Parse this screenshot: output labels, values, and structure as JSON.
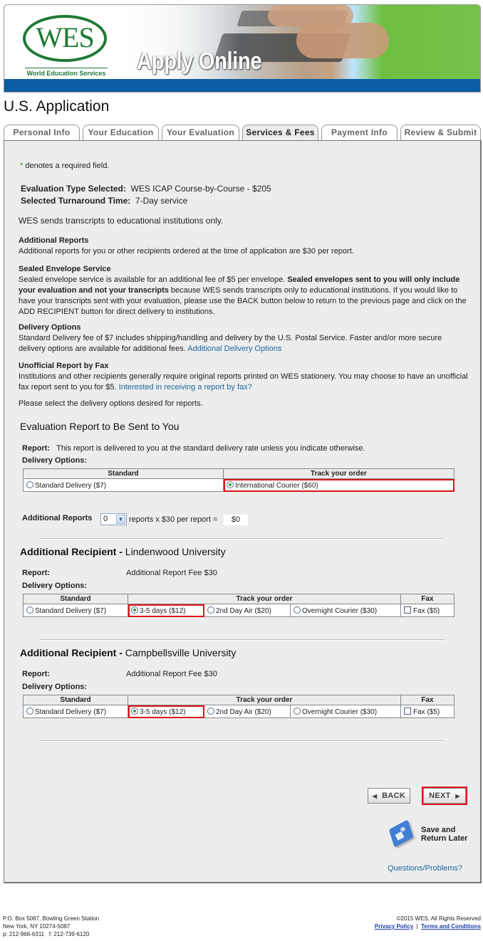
{
  "header": {
    "logo_text": "WES",
    "logo_subtitle": "World Education Services",
    "banner_title": "Apply Online",
    "brand_color": "#1e7a33",
    "bar_color": "#0a5ea6"
  },
  "page_title": "U.S. Application",
  "tabs": [
    {
      "label": "Personal Info",
      "active": false
    },
    {
      "label": "Your Education",
      "active": false
    },
    {
      "label": "Your Evaluation",
      "active": false
    },
    {
      "label": "Services & Fees",
      "active": true
    },
    {
      "label": "Payment Info",
      "active": false
    },
    {
      "label": "Review & Submit",
      "active": false
    }
  ],
  "intro": {
    "required_marker": "*",
    "required_note": " denotes a required field.",
    "eval_type_label": "Evaluation Type Selected:",
    "eval_type_value": "WES ICAP Course-by-Course - $205",
    "turnaround_label": "Selected Turnaround Time:",
    "turnaround_value": "7-Day service",
    "transcripts_note": "WES sends transcripts to educational institutions only."
  },
  "info_sections": {
    "additional_reports": {
      "heading": "Additional Reports",
      "text": "Additional reports for you or other recipients ordered at the time of application are $30 per report."
    },
    "sealed_envelope": {
      "heading": "Sealed Envelope Service",
      "text_1": "Sealed envelope service is available for an additional fee of $5 per envelope. ",
      "text_bold": "Sealed envelopes sent to you will only include your evaluation and not your transcripts",
      "text_2": " because WES sends transcripts only to educational institutions. If you would like to have your transcripts sent with your evaluation, please use the BACK button below to return to the previous page and click on the ADD RECIPIENT button for direct delivery to institutions."
    },
    "delivery_options": {
      "heading": "Delivery Options",
      "text": "Standard Delivery fee of $7 includes shipping/handling and delivery by the U.S. Postal Service. Faster and/or more secure delivery options are available for additional fees. ",
      "link": "Additional Delivery Options"
    },
    "fax": {
      "heading": "Unofficial Report by Fax",
      "text": "Institutions and other recipients generally require original reports printed on WES stationery. You may choose to have an unofficial fax report sent to you for $5. ",
      "link": "Interested in receiving a report by fax?"
    },
    "select_prompt": "Please select the delivery options desired for reports."
  },
  "eval_report": {
    "heading": "Evaluation Report to Be Sent to You",
    "report_label": "Report:",
    "report_text": "This report is delivered to you at the standard delivery rate unless you indicate otherwise.",
    "delivery_label": "Delivery Options:",
    "col_standard": "Standard",
    "col_track": "Track your order",
    "option_standard": "Standard Delivery ($7)",
    "option_courier": "International Courier ($60)",
    "selected": "International Courier ($60)"
  },
  "additional_reports_calc": {
    "label": "Additional Reports",
    "quantity": "0",
    "text": "reports x $30 per report =",
    "total": "$0"
  },
  "recipients": [
    {
      "heading_label": "Additional Recipient - ",
      "name": "Lindenwood University",
      "report_label": "Report:",
      "report_fee": "Additional Report Fee $30",
      "delivery_label": "Delivery Options:",
      "col_standard": "Standard",
      "col_track": "Track your order",
      "col_fax": "Fax",
      "options": {
        "standard": "Standard Delivery ($7)",
        "days35": "3-5 days ($12)",
        "air2": "2nd Day Air ($20)",
        "overnight": "Overnight Courier ($30)",
        "fax": "Fax ($5)"
      },
      "selected": "3-5 days ($12)",
      "fax_checked": false
    },
    {
      "heading_label": "Additional Recipient - ",
      "name": "Campbellsville University",
      "report_label": "Report:",
      "report_fee": "Additional Report Fee $30",
      "delivery_label": "Delivery Options:",
      "col_standard": "Standard",
      "col_track": "Track your order",
      "col_fax": "Fax",
      "options": {
        "standard": "Standard Delivery ($7)",
        "days35": "3-5 days ($12)",
        "air2": "2nd Day Air ($20)",
        "overnight": "Overnight Courier ($30)",
        "fax": "Fax ($5)"
      },
      "selected": "3-5 days ($12)",
      "fax_checked": false
    }
  ],
  "nav": {
    "back_label": "BACK",
    "next_label": "NEXT",
    "save_line1": "Save and",
    "save_line2": "Return Later",
    "questions_link": "Questions/Problems?",
    "highlight_color": "#e0141b"
  },
  "footer": {
    "address_1": "P.O. Box 5087, Bowling Green Station",
    "address_2": "New York, NY 10274-5087",
    "phone": "p: 212-966-6311   f: 212-739-6120",
    "copyright": "©2015 WES, All Rights Reserved",
    "privacy": "Privacy Policy",
    "separator": "|",
    "terms": "Terms and Conditions"
  }
}
